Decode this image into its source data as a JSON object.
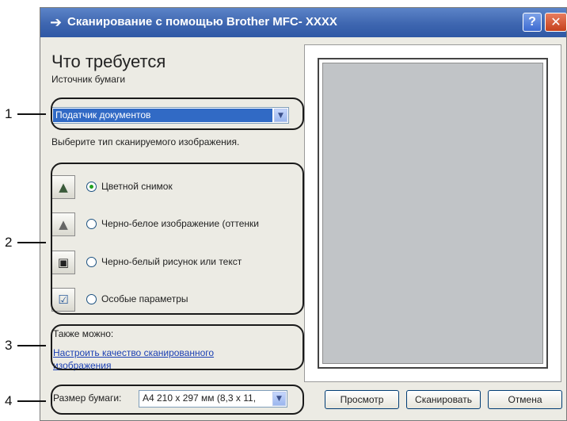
{
  "window": {
    "title": "Сканирование с помощью Brother MFC- XXXX",
    "title_icon": "arrow-right-icon",
    "help_label": "?",
    "close_label": "✕"
  },
  "main": {
    "heading": "Что требуется",
    "source_label": "Источник бумаги",
    "source_value": "Податчик документов",
    "scan_type_prompt": "Выберите тип сканируемого изображения.",
    "options": [
      {
        "label": "Цветной снимок",
        "icon": "color-photo-icon",
        "checked": true
      },
      {
        "label": "Черно-белое изображение (оттенки",
        "icon": "grayscale-photo-icon",
        "checked": false
      },
      {
        "label": "Черно-белый рисунок или текст",
        "icon": "bw-text-icon",
        "checked": false
      },
      {
        "label": "Особые параметры",
        "icon": "custom-settings-icon",
        "checked": false
      }
    ],
    "also_label": "Также можно:",
    "quality_link": "Настроить качество сканированного изображения",
    "paper_size_label": "Размер бумаги:",
    "paper_size_value": "A4 210 x 297 мм (8,3 x 11,"
  },
  "buttons": {
    "preview": "Просмотр",
    "scan": "Сканировать",
    "cancel": "Отмена"
  },
  "callouts": [
    "1",
    "2",
    "3",
    "4"
  ],
  "colors": {
    "titlebar": "#3e66b0",
    "selection": "#316ac5",
    "link": "#1a3fb3",
    "dialog_bg": "#ecebe4"
  }
}
